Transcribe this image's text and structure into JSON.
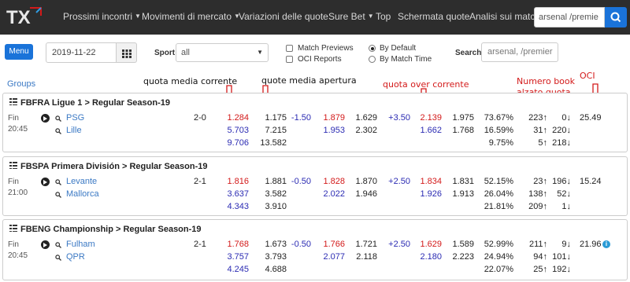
{
  "nav": {
    "logo_text": "TX",
    "items": [
      {
        "label": "Prossimi incontri",
        "dropdown": true
      },
      {
        "label": "Movimenti di mercato",
        "dropdown": true
      },
      {
        "label": "Variazioni delle quote",
        "dropdown": false
      },
      {
        "label": "Sure Bet",
        "dropdown": true
      },
      {
        "label": "Top",
        "dropdown": false
      },
      {
        "label": "Schermata quote",
        "dropdown": false
      },
      {
        "label": "Analisi sui matc",
        "dropdown": false
      }
    ],
    "search_value": "arsenal /premie",
    "search_icon": "search-icon"
  },
  "filters": {
    "menu_label": "Menu",
    "date_value": "2019-11-22",
    "calendar_icon": "calendar-grid-icon",
    "sport_label": "Sport",
    "sport_value": "all",
    "checkboxes": [
      {
        "label": "Match Previews",
        "checked": false
      },
      {
        "label": "OCI Reports",
        "checked": false
      }
    ],
    "radios": [
      {
        "label": "By Default",
        "selected": true
      },
      {
        "label": "By Match Time",
        "selected": false
      }
    ],
    "search_label": "Search",
    "search_value": "arsenal, /premier"
  },
  "groups_link": "Groups",
  "annotations": {
    "quota_media_corrente": "quota media corrente",
    "quota_media_apertura": "quote media apertura",
    "quota_over_corrente": "quota over corrente",
    "numero_book_line1": "Numero book",
    "numero_book_line2": "alzato quota",
    "oci": "OCI"
  },
  "colors": {
    "navbar": "#2d2d2d",
    "accent_blue": "#1a73d9",
    "link_blue": "#3b79c4",
    "odds_red": "#d31a1a",
    "odds_blue": "#2b2bb3",
    "annotation_red": "#d31a1a"
  },
  "groups": [
    {
      "title": "FBFRA Ligue 1 > Regular Season-19",
      "status": "Fin",
      "time": "20:45",
      "score": "2-0",
      "oci": "25.49",
      "info": false,
      "rows": [
        {
          "team": "PSG",
          "cur": "1.284",
          "open": "1.175",
          "hcp": "-1.50",
          "h1": "1.879",
          "h2": "1.629",
          "ou": "+3.50",
          "o1": "2.139",
          "o2": "1.975",
          "pct1": "73.67%",
          "b1": "223↑",
          "b2": "0↓"
        },
        {
          "team": "Lille",
          "cur": "5.703",
          "open": "7.215",
          "hcp": "",
          "h1": "1.953",
          "h2": "2.302",
          "ou": "",
          "o1": "1.662",
          "o2": "1.768",
          "pct1": "16.59%",
          "b1": "31↑",
          "b2": "220↓"
        },
        {
          "team": "",
          "cur": "9.706",
          "open": "13.582",
          "hcp": "",
          "h1": "",
          "h2": "",
          "ou": "",
          "o1": "",
          "o2": "",
          "pct1": "9.75%",
          "b1": "5↑",
          "b2": "218↓"
        }
      ]
    },
    {
      "title": "FBSPA Primera División > Regular Season-19",
      "status": "Fin",
      "time": "21:00",
      "score": "2-1",
      "oci": "15.24",
      "info": false,
      "rows": [
        {
          "team": "Levante",
          "cur": "1.816",
          "open": "1.881",
          "hcp": "-0.50",
          "h1": "1.828",
          "h2": "1.870",
          "ou": "+2.50",
          "o1": "1.834",
          "o2": "1.831",
          "pct1": "52.15%",
          "b1": "23↑",
          "b2": "196↓"
        },
        {
          "team": "Mallorca",
          "cur": "3.637",
          "open": "3.582",
          "hcp": "",
          "h1": "2.022",
          "h2": "1.946",
          "ou": "",
          "o1": "1.926",
          "o2": "1.913",
          "pct1": "26.04%",
          "b1": "138↑",
          "b2": "52↓"
        },
        {
          "team": "",
          "cur": "4.343",
          "open": "3.910",
          "hcp": "",
          "h1": "",
          "h2": "",
          "ou": "",
          "o1": "",
          "o2": "",
          "pct1": "21.81%",
          "b1": "209↑",
          "b2": "1↓"
        }
      ]
    },
    {
      "title": "FBENG Championship > Regular Season-19",
      "status": "Fin",
      "time": "20:45",
      "score": "2-1",
      "oci": "21.96",
      "info": true,
      "rows": [
        {
          "team": "Fulham",
          "cur": "1.768",
          "open": "1.673",
          "hcp": "-0.50",
          "h1": "1.766",
          "h2": "1.721",
          "ou": "+2.50",
          "o1": "1.629",
          "o2": "1.589",
          "pct1": "52.99%",
          "b1": "211↑",
          "b2": "9↓"
        },
        {
          "team": "QPR",
          "cur": "3.757",
          "open": "3.793",
          "hcp": "",
          "h1": "2.077",
          "h2": "2.118",
          "ou": "",
          "o1": "2.180",
          "o2": "2.223",
          "pct1": "24.94%",
          "b1": "94↑",
          "b2": "101↓"
        },
        {
          "team": "",
          "cur": "4.245",
          "open": "4.688",
          "hcp": "",
          "h1": "",
          "h2": "",
          "ou": "",
          "o1": "",
          "o2": "",
          "pct1": "22.07%",
          "b1": "25↑",
          "b2": "192↓"
        }
      ]
    }
  ]
}
